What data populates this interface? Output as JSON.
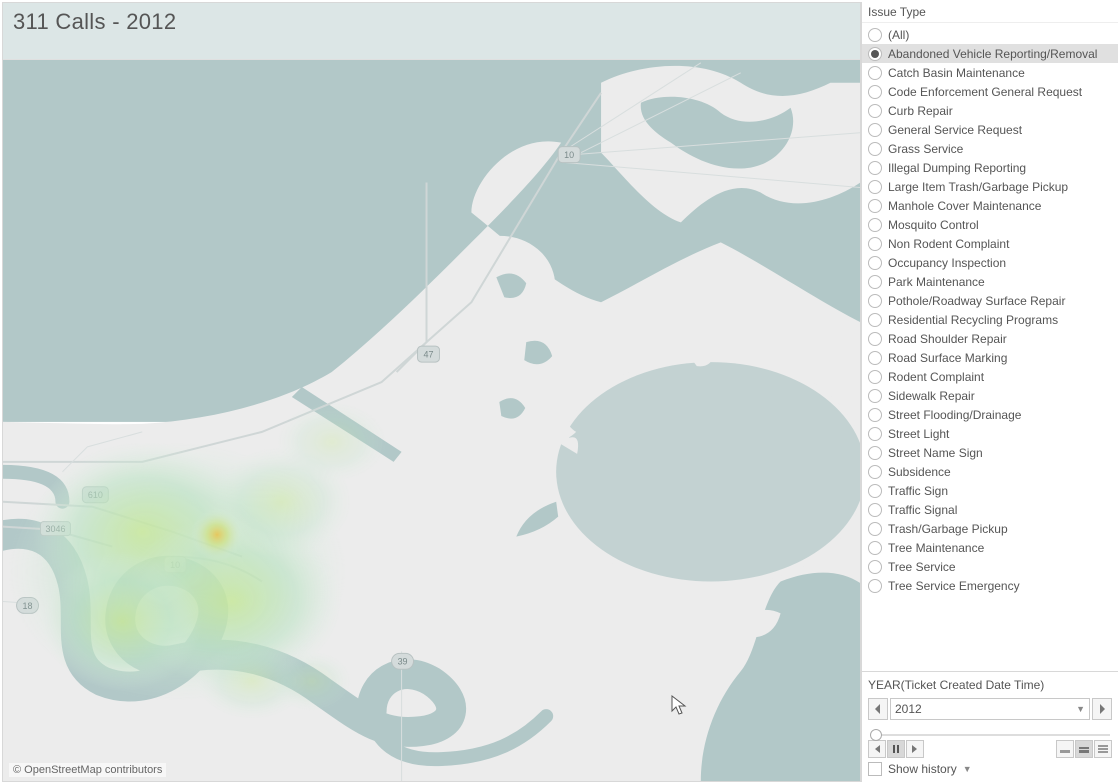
{
  "title": "311 Calls - 2012",
  "attribution": "© OpenStreetMap contributors",
  "filter": {
    "header": "Issue Type",
    "selected": "Abandoned Vehicle Reporting/Removal",
    "items": [
      "(All)",
      "Abandoned Vehicle Reporting/Removal",
      "Catch Basin Maintenance",
      "Code Enforcement General Request",
      "Curb Repair",
      "General Service Request",
      "Grass Service",
      "Illegal Dumping Reporting",
      "Large Item Trash/Garbage Pickup",
      "Manhole Cover Maintenance",
      "Mosquito Control",
      "Non Rodent Complaint",
      "Occupancy Inspection",
      "Park Maintenance",
      "Pothole/Roadway Surface Repair",
      "Residential Recycling Programs",
      "Road Shoulder Repair",
      "Road Surface Marking",
      "Rodent Complaint",
      "Sidewalk Repair",
      "Street Flooding/Drainage",
      "Street Light",
      "Street Name Sign",
      "Subsidence",
      "Traffic Sign",
      "Traffic Signal",
      "Trash/Garbage Pickup",
      "Tree Maintenance",
      "Tree Service",
      "Tree Service Emergency"
    ]
  },
  "year": {
    "header": "YEAR(Ticket Created Date Time)",
    "value": "2012",
    "show_history_label": "Show history"
  },
  "map": {
    "roads": [
      "10",
      "47",
      "610",
      "3046",
      "18",
      "39",
      "10"
    ],
    "heatmap_note": "density concentrated SW of center"
  }
}
